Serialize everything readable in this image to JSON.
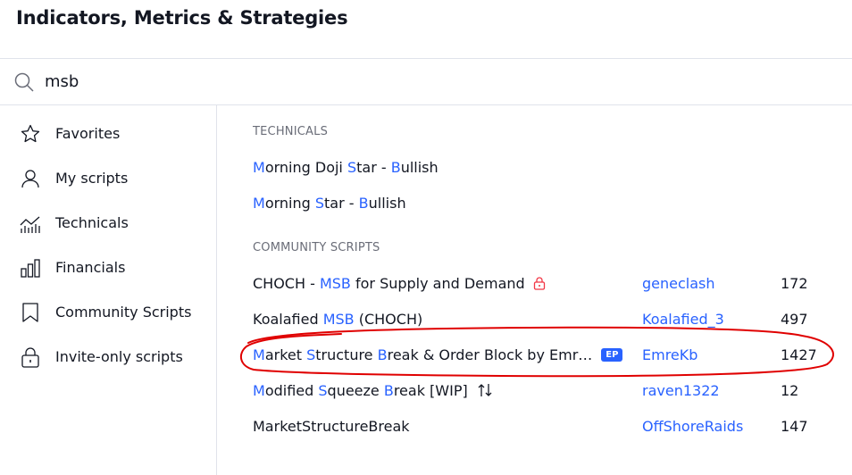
{
  "header": {
    "title": "Indicators, Metrics & Strategies"
  },
  "search": {
    "value": "msb"
  },
  "sidebar": {
    "items": [
      {
        "label": "Favorites",
        "icon": "star-icon"
      },
      {
        "label": "My scripts",
        "icon": "user-icon"
      },
      {
        "label": "Technicals",
        "icon": "technicals-chart-icon"
      },
      {
        "label": "Financials",
        "icon": "bar-chart-icon"
      },
      {
        "label": "Community Scripts",
        "icon": "bookmark-icon"
      },
      {
        "label": "Invite-only scripts",
        "icon": "lock-icon"
      }
    ]
  },
  "technicals": {
    "heading": "TECHNICALS",
    "items": [
      {
        "name": "Morning Doji Star - Bullish"
      },
      {
        "name": "Morning Star - Bullish"
      }
    ]
  },
  "community": {
    "heading": "COMMUNITY SCRIPTS",
    "items": [
      {
        "name": "CHOCH - MSB for Supply and Demand",
        "author": "geneclash",
        "count": "172"
      },
      {
        "name": "Koalafied MSB (CHOCH)",
        "author": "Koalafied_3",
        "count": "497"
      },
      {
        "name": "Market Structure Break & Order Block by Emr…",
        "badge": "EP",
        "author": "EmreKb",
        "count": "1427"
      },
      {
        "name": "Modified Squeeze Break [WIP]",
        "author": "raven1322",
        "count": "12"
      },
      {
        "name": "MarketStructureBreak",
        "author": "OffShoreRaids",
        "count": "147"
      }
    ]
  },
  "colors": {
    "accent": "#2962ff",
    "annotation": "#e00000",
    "lock": "#f23645"
  }
}
